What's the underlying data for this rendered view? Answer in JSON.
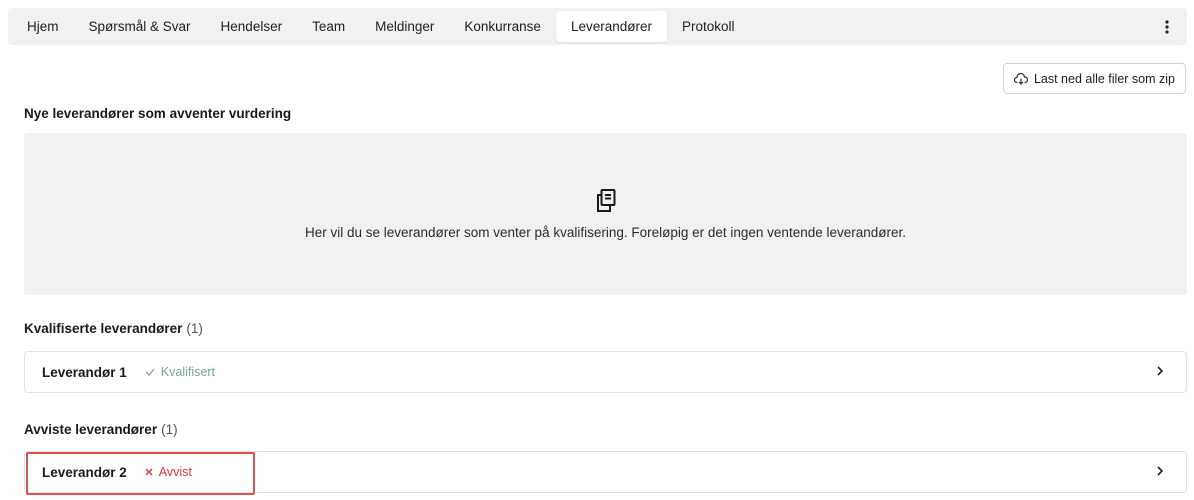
{
  "tabs": [
    {
      "label": "Hjem",
      "active": false
    },
    {
      "label": "Spørsmål & Svar",
      "active": false
    },
    {
      "label": "Hendelser",
      "active": false
    },
    {
      "label": "Team",
      "active": false
    },
    {
      "label": "Meldinger",
      "active": false
    },
    {
      "label": "Konkurranse",
      "active": false
    },
    {
      "label": "Leverandører",
      "active": true
    },
    {
      "label": "Protokoll",
      "active": false
    }
  ],
  "toolbar": {
    "download_zip_label": "Last ned alle filer som zip",
    "download_icon": "cloud-download-icon"
  },
  "pending": {
    "title": "Nye leverandører som avventer vurdering",
    "empty_icon": "documents-icon",
    "empty_text": "Her vil du se leverandører som venter på kvalifisering. Foreløpig er det ingen ventende leverandører."
  },
  "qualified": {
    "title": "Kvalifiserte leverandører",
    "count": "(1)",
    "items": [
      {
        "name": "Leverandør 1",
        "status": "Kvalifisert",
        "status_color": "#7aa78e"
      }
    ]
  },
  "rejected": {
    "title": "Avviste leverandører",
    "count": "(1)",
    "items": [
      {
        "name": "Leverandør 2",
        "status": "Avvist",
        "status_color": "#d8383d"
      }
    ]
  },
  "colors": {
    "highlight": "#d9534f",
    "tabbar_bg": "#f0f1f3"
  }
}
